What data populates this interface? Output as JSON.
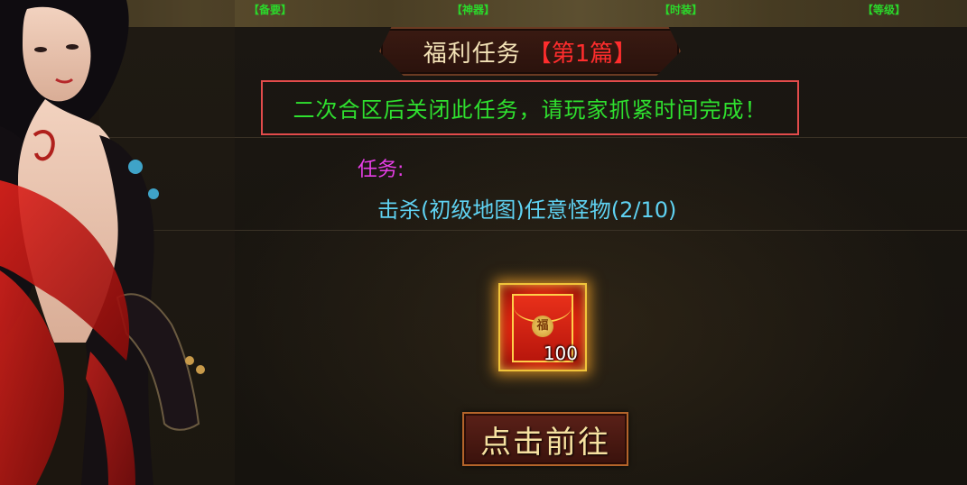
{
  "top_tabs": [
    "【备要】",
    "【神器】",
    "【时装】",
    "【等级】"
  ],
  "title": {
    "text": "福利任务",
    "chapter": "【第1篇】"
  },
  "notice": "二次合区后关闭此任务，请玩家抓紧时间完成！",
  "task": {
    "label": "任务:",
    "description": "击杀(初级地图)任意怪物(2/10)"
  },
  "reward": {
    "icon": "red-envelope-icon",
    "seal": "福",
    "quantity": "100"
  },
  "go_button": {
    "label": "点击前往"
  },
  "colors": {
    "title": "#f3e2b6",
    "chapter": "#ff2d2d",
    "notice": "#2fe02f",
    "notice_border": "#e24b4b",
    "task_label": "#e63ee6",
    "task_desc": "#5fd2f2",
    "button_text": "#f6e1a0"
  }
}
